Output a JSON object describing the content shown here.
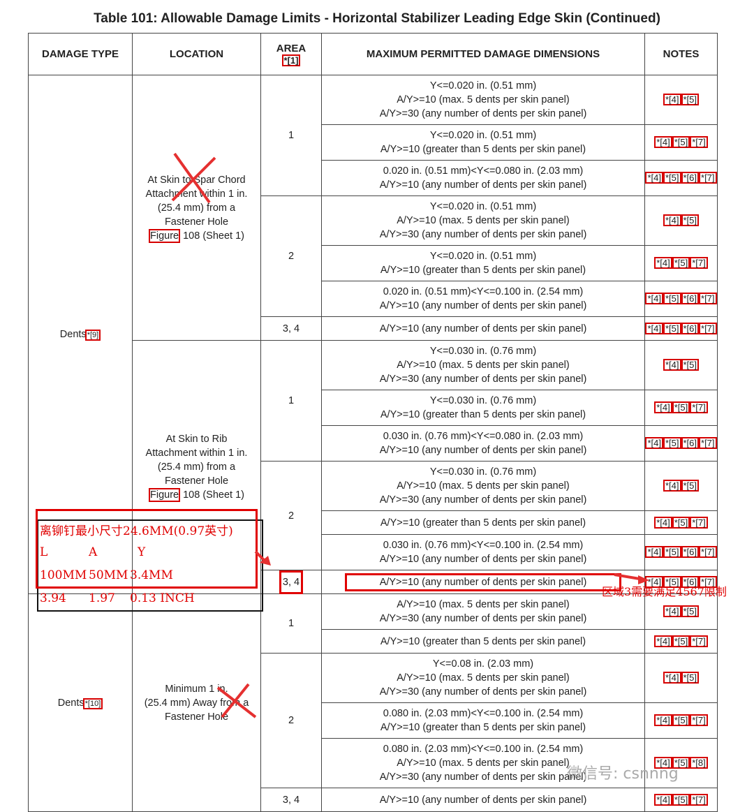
{
  "title": "Table 101:  Allowable Damage Limits - Horizontal Stabilizer Leading Edge Skin (Continued)",
  "headers": {
    "damage_type": "DAMAGE TYPE",
    "location": "LOCATION",
    "area": "AREA",
    "area_ref": "*[1]",
    "max_dims": "MAXIMUM PERMITTED DAMAGE DIMENSIONS",
    "notes": "NOTES"
  },
  "groups": [
    {
      "type": "Dents",
      "type_ref": "*[9]",
      "locations": [
        {
          "lines": [
            "At Skin to Spar Chord",
            "Attachment within 1 in.",
            "(25.4 mm) from a",
            "Fastener Hole"
          ],
          "fig": "Figure",
          "fig_tail": " 108 (Sheet 1)",
          "areas": [
            {
              "area": "1",
              "rows": [
                {
                  "dims": [
                    "Y<=0.020 in. (0.51 mm)",
                    "A/Y>=10 (max. 5 dents per skin panel)",
                    "A/Y>=30 (any number of dents per skin panel)"
                  ],
                  "notes": [
                    "*[4]",
                    "*[5]"
                  ]
                },
                {
                  "dims": [
                    "Y<=0.020 in. (0.51 mm)",
                    "A/Y>=10 (greater than 5 dents per skin panel)"
                  ],
                  "notes": [
                    "*[4]",
                    "*[5]",
                    "*[7]"
                  ]
                },
                {
                  "dims": [
                    "0.020 in. (0.51 mm)<Y<=0.080 in. (2.03 mm)",
                    "A/Y>=10 (any number of dents per skin panel)"
                  ],
                  "notes": [
                    "*[4]",
                    "*[5]",
                    "*[6]",
                    "*[7]"
                  ]
                }
              ]
            },
            {
              "area": "2",
              "rows": [
                {
                  "dims": [
                    "Y<=0.020 in. (0.51 mm)",
                    "A/Y>=10 (max. 5 dents per skin panel)",
                    "A/Y>=30 (any number of dents per skin panel)"
                  ],
                  "notes": [
                    "*[4]",
                    "*[5]"
                  ]
                },
                {
                  "dims": [
                    "Y<=0.020 in. (0.51 mm)",
                    "A/Y>=10 (greater than 5 dents per skin panel)"
                  ],
                  "notes": [
                    "*[4]",
                    "*[5]",
                    "*[7]"
                  ]
                },
                {
                  "dims": [
                    "0.020 in. (0.51 mm)<Y<=0.100 in. (2.54 mm)",
                    "A/Y>=10 (any number of dents per skin panel)"
                  ],
                  "notes": [
                    "*[4]",
                    "*[5]",
                    "*[6]",
                    "*[7]"
                  ]
                }
              ]
            },
            {
              "area": "3, 4",
              "rows": [
                {
                  "dims": [
                    "A/Y>=10 (any number of dents per skin panel)"
                  ],
                  "notes": [
                    "*[4]",
                    "*[5]",
                    "*[6]",
                    "*[7]"
                  ]
                }
              ]
            }
          ]
        },
        {
          "lines": [
            "At Skin to Rib",
            "Attachment within 1 in.",
            "(25.4 mm) from a",
            "Fastener Hole"
          ],
          "fig": "Figure",
          "fig_tail": " 108 (Sheet 1)",
          "areas": [
            {
              "area": "1",
              "rows": [
                {
                  "dims": [
                    "Y<=0.030 in. (0.76 mm)",
                    "A/Y>=10 (max. 5 dents per skin panel)",
                    "A/Y>=30 (any number of dents per skin panel)"
                  ],
                  "notes": [
                    "*[4]",
                    "*[5]"
                  ]
                },
                {
                  "dims": [
                    "Y<=0.030 in. (0.76 mm)",
                    "A/Y>=10 (greater than 5 dents per skin panel)"
                  ],
                  "notes": [
                    "*[4]",
                    "*[5]",
                    "*[7]"
                  ]
                },
                {
                  "dims": [
                    "0.030 in. (0.76 mm)<Y<=0.080 in. (2.03 mm)",
                    "A/Y>=10 (any number of dents per skin panel)"
                  ],
                  "notes": [
                    "*[4]",
                    "*[5]",
                    "*[6]",
                    "*[7]"
                  ]
                }
              ]
            },
            {
              "area": "2",
              "rows": [
                {
                  "dims": [
                    "Y<=0.030 in. (0.76 mm)",
                    "A/Y>=10 (max. 5 dents per skin panel)",
                    "A/Y>=30 (any number of dents per skin panel)"
                  ],
                  "notes": [
                    "*[4]",
                    "*[5]"
                  ]
                },
                {
                  "dims": [
                    "A/Y>=10 (greater than 5 dents per skin panel)"
                  ],
                  "notes": [
                    "*[4]",
                    "*[5]",
                    "*[7]"
                  ]
                },
                {
                  "dims": [
                    "0.030 in. (0.76 mm)<Y<=0.100 in. (2.54 mm)",
                    "A/Y>=10 (any number of dents per skin panel)"
                  ],
                  "notes": [
                    "*[4]",
                    "*[5]",
                    "*[6]",
                    "*[7]"
                  ]
                }
              ]
            },
            {
              "area": "3, 4",
              "highlight": true,
              "rows": [
                {
                  "dims": [
                    "A/Y>=10 (any number of dents per skin panel)"
                  ],
                  "notes": [
                    "*[4]",
                    "*[5]",
                    "*[6]",
                    "*[7]"
                  ],
                  "highlight": true
                }
              ]
            }
          ]
        }
      ]
    },
    {
      "type": "Dents",
      "type_ref": "*[10]",
      "locations": [
        {
          "lines": [
            "Minimum 1 in.",
            "(25.4 mm) Away from a",
            "Fastener Hole"
          ],
          "fig": "",
          "fig_tail": "",
          "areas": [
            {
              "area": "1",
              "rows": [
                {
                  "dims": [
                    "A/Y>=10 (max. 5 dents per skin panel)",
                    "A/Y>=30 (any number of dents per skin panel)"
                  ],
                  "notes": [
                    "*[4]",
                    "*[5]"
                  ]
                },
                {
                  "dims": [
                    "A/Y>=10 (greater than 5 dents per skin panel)"
                  ],
                  "notes": [
                    "*[4]",
                    "*[5]",
                    "*[7]"
                  ]
                }
              ]
            },
            {
              "area": "2",
              "rows": [
                {
                  "dims": [
                    "Y<=0.08 in. (2.03 mm)",
                    "A/Y>=10 (max. 5 dents per skin panel)",
                    "A/Y>=30 (any number of dents per skin panel)"
                  ],
                  "notes": [
                    "*[4]",
                    "*[5]"
                  ]
                },
                {
                  "dims": [
                    "0.080 in. (2.03 mm)<Y<=0.100 in. (2.54 mm)",
                    "A/Y>=10 (greater than 5 dents per skin panel)"
                  ],
                  "notes": [
                    "*[4]",
                    "*[5]",
                    "*[7]"
                  ]
                },
                {
                  "dims": [
                    "0.080 in. (2.03 mm)<Y<=0.100 in. (2.54 mm)",
                    "A/Y>=10 (max. 5 dents per skin panel)",
                    "A/Y>=30 (any number of dents per skin panel)"
                  ],
                  "notes": [
                    "*[4]",
                    "*[5]",
                    "*[8]"
                  ]
                }
              ]
            },
            {
              "area": "3, 4",
              "rows": [
                {
                  "dims": [
                    "A/Y>=10 (any number of dents per skin panel)"
                  ],
                  "notes": [
                    "*[4]",
                    "*[5]",
                    "*[7]"
                  ]
                }
              ]
            }
          ]
        }
      ]
    }
  ],
  "annotations": {
    "note_line1": "离铆钉最小尺寸24.6MM(0.97英寸)",
    "col_headers": [
      "L",
      "A",
      "Y"
    ],
    "row_mm": [
      "100MM",
      "50MM",
      "3.4MM"
    ],
    "row_inch": [
      "3.94",
      "1.97",
      "0.13 INCH"
    ],
    "side_note": "区域3需要满足4567限制",
    "watermark": "微信号: csnnng",
    "color": "#e00000"
  }
}
